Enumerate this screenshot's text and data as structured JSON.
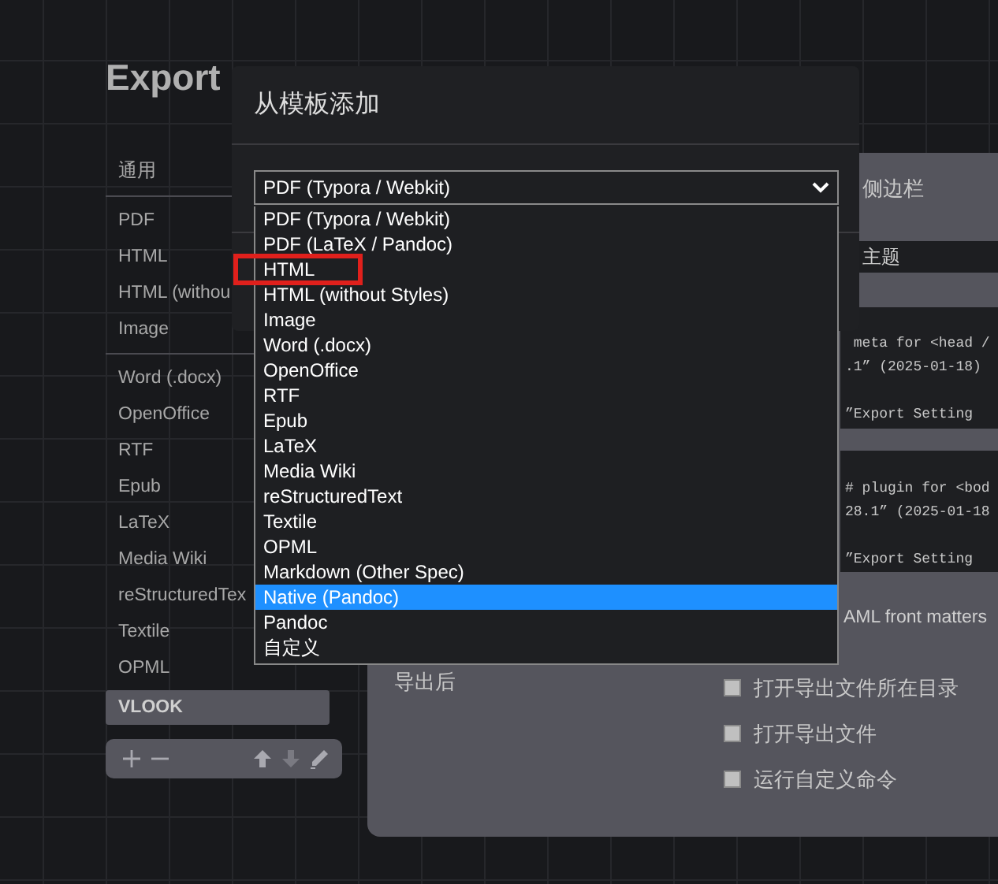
{
  "page": {
    "title": "Export"
  },
  "sidebar": {
    "sections": [
      {
        "header": "通用",
        "items": [
          {
            "label": "PDF",
            "selected": false
          },
          {
            "label": "HTML",
            "selected": false
          },
          {
            "label": "HTML (withou",
            "selected": false
          },
          {
            "label": "Image",
            "selected": false
          }
        ]
      },
      {
        "items": [
          {
            "label": "Word (.docx)",
            "selected": false
          },
          {
            "label": "OpenOffice",
            "selected": false
          },
          {
            "label": "RTF",
            "selected": false
          },
          {
            "label": "Epub",
            "selected": false
          },
          {
            "label": "LaTeX",
            "selected": false
          },
          {
            "label": "Media Wiki",
            "selected": false
          },
          {
            "label": "reStructuredTex",
            "selected": false
          },
          {
            "label": "Textile",
            "selected": false
          },
          {
            "label": "OPML",
            "selected": false
          },
          {
            "label": "VLOOK",
            "selected": true
          }
        ]
      }
    ],
    "toolbar": [
      {
        "kind": "add",
        "disabled": false
      },
      {
        "kind": "remove",
        "disabled": false
      },
      {
        "kind": "up",
        "disabled": false
      },
      {
        "kind": "down",
        "disabled": true
      },
      {
        "kind": "edit",
        "disabled": false
      }
    ]
  },
  "panel": {
    "sidebar_label": "侧边栏",
    "theme_select": "主题",
    "code_blocks": [
      {
        "lines": [
          " meta for <head /",
          ".1” (2025-01-18)"
        ],
        "note": "”Export Setting"
      },
      {
        "lines": [
          "# plugin for <bod",
          "28.1” (2025-01-18"
        ],
        "note": "”Export Setting"
      }
    ],
    "yaml_label": "AML front matters",
    "after_export": {
      "label": "导出后",
      "options": [
        {
          "label": "打开导出文件所在目录",
          "checked": false
        },
        {
          "label": "打开导出文件",
          "checked": false
        },
        {
          "label": "运行自定义命令",
          "checked": false
        }
      ]
    }
  },
  "dialog": {
    "title": "从模板添加",
    "select": {
      "value": "PDF (Typora / Webkit)",
      "options": [
        {
          "label": "PDF (Typora / Webkit)",
          "highlighted": false
        },
        {
          "label": "PDF (LaTeX / Pandoc)",
          "highlighted": false
        },
        {
          "label": "HTML",
          "highlighted": false
        },
        {
          "label": "HTML (without Styles)",
          "highlighted": false
        },
        {
          "label": "Image",
          "highlighted": false
        },
        {
          "label": "Word (.docx)",
          "highlighted": false
        },
        {
          "label": "OpenOffice",
          "highlighted": false
        },
        {
          "label": "RTF",
          "highlighted": false
        },
        {
          "label": "Epub",
          "highlighted": false
        },
        {
          "label": "LaTeX",
          "highlighted": false
        },
        {
          "label": "Media Wiki",
          "highlighted": false
        },
        {
          "label": "reStructuredText",
          "highlighted": false
        },
        {
          "label": "Textile",
          "highlighted": false
        },
        {
          "label": "OPML",
          "highlighted": false
        },
        {
          "label": "Markdown (Other Spec)",
          "highlighted": false
        },
        {
          "label": "Native (Pandoc)",
          "highlighted": true
        },
        {
          "label": "Pandoc",
          "highlighted": false
        },
        {
          "label": "自定义",
          "highlighted": false
        }
      ]
    }
  }
}
